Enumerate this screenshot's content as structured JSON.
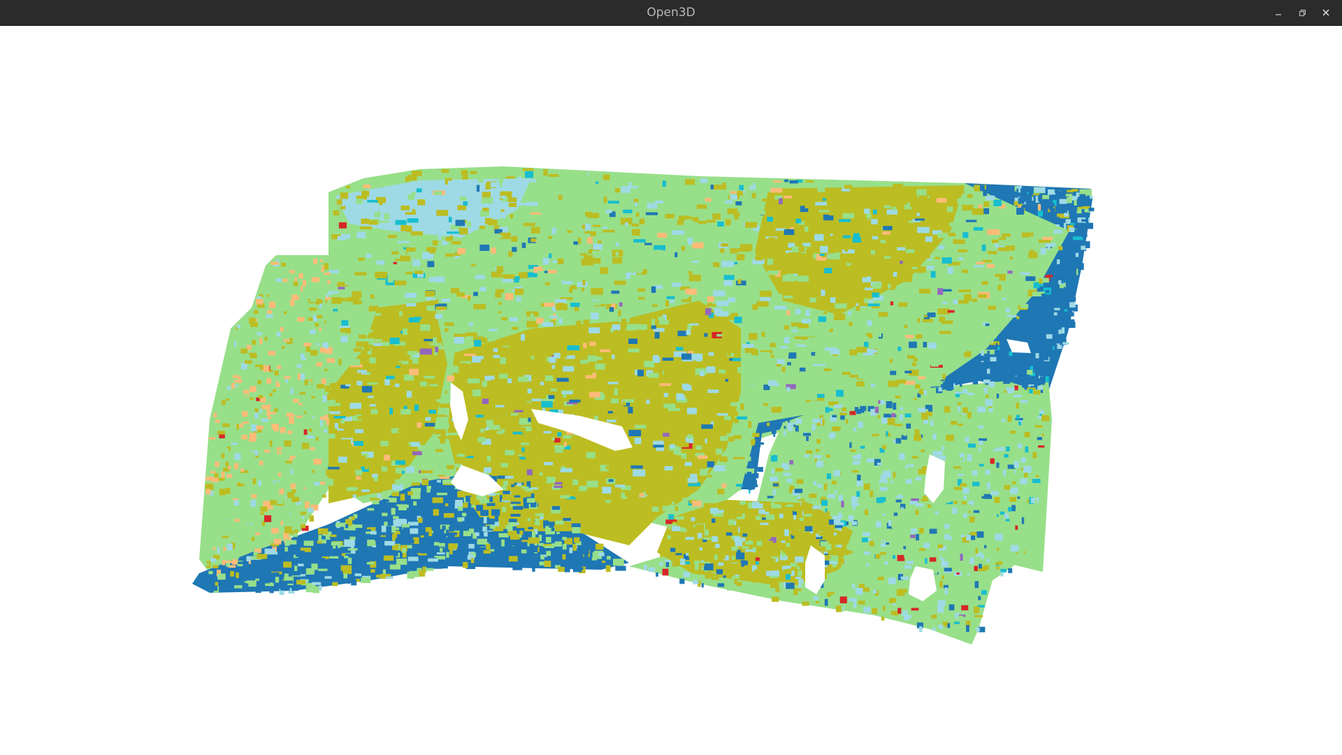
{
  "window": {
    "title": "Open3D",
    "controls": {
      "minimize_icon": "minimize-icon",
      "maximize_icon": "restore-icon",
      "close_icon": "close-icon"
    }
  },
  "viewer": {
    "background": "#ffffff",
    "palette": {
      "blue": "#1f77b4",
      "light_green": "#98df8a",
      "olive": "#bcbd22",
      "light_blue": "#9edae5",
      "cyan": "#17becf",
      "peach": "#ffbb78",
      "red": "#d62728",
      "purple": "#9467bd",
      "pink": "#f7b6d2"
    }
  }
}
